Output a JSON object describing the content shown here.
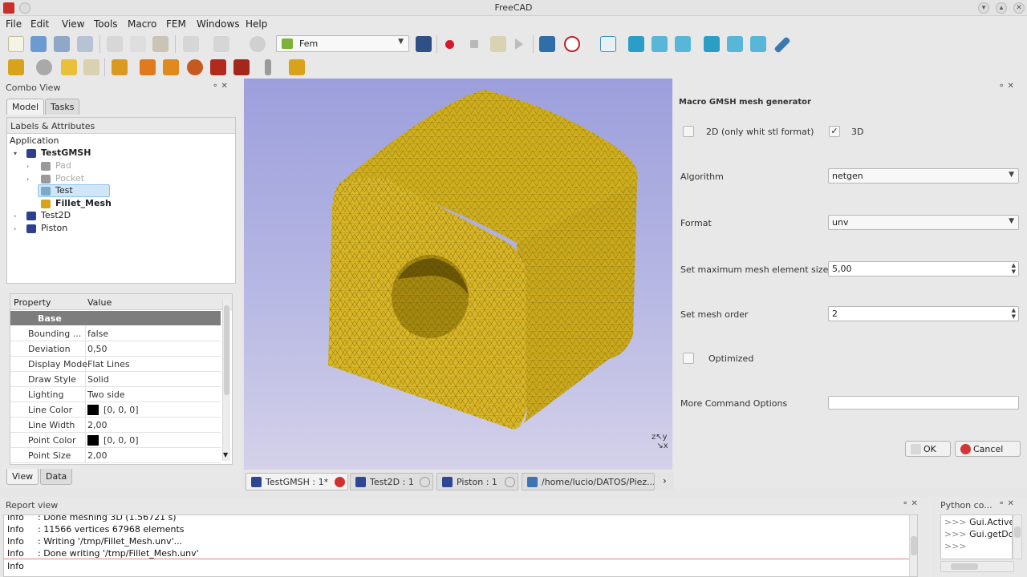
{
  "window": {
    "title": "FreeCAD"
  },
  "menu": [
    "File",
    "Edit",
    "View",
    "Tools",
    "Macro",
    "FEM",
    "Windows",
    "Help"
  ],
  "toolbar": {
    "workbench": "Fem"
  },
  "combo_view": {
    "title": "Combo View",
    "tabs": [
      "Model",
      "Tasks"
    ],
    "tree": {
      "header": "Labels & Attributes",
      "root": "Application",
      "items": [
        "TestGMSH",
        "Pad",
        "Pocket",
        "Test",
        "Fillet_Mesh",
        "Test2D",
        "Piston"
      ]
    },
    "properties": {
      "col_property": "Property",
      "col_value": "Value",
      "group": "Base",
      "rows": [
        {
          "name": "Bounding ...",
          "value": "false"
        },
        {
          "name": "Deviation",
          "value": "0,50"
        },
        {
          "name": "Display Mode",
          "value": "Flat Lines"
        },
        {
          "name": "Draw Style",
          "value": "Solid"
        },
        {
          "name": "Lighting",
          "value": "Two side"
        },
        {
          "name": "Line Color",
          "value": "[0, 0, 0]"
        },
        {
          "name": "Line Width",
          "value": "2,00"
        },
        {
          "name": "Point Color",
          "value": "[0, 0, 0]"
        },
        {
          "name": "Point Size",
          "value": "2,00"
        }
      ]
    },
    "bottom_tabs": [
      "View",
      "Data"
    ]
  },
  "doc_tabs": [
    "TestGMSH : 1*",
    "Test2D : 1",
    "Piston : 1",
    "/home/lucio/DATOS/Piez..."
  ],
  "task_panel": {
    "title": "Macro GMSH mesh generator",
    "opt_2d_label": "2D (only whit stl format)",
    "opt_2d_checked": false,
    "opt_3d_label": "3D",
    "opt_3d_checked": true,
    "algorithm_label": "Algorithm",
    "algorithm_value": "netgen",
    "format_label": "Format",
    "format_value": "unv",
    "max_size_label": "Set maximum mesh element size",
    "max_size_value": "5,00",
    "order_label": "Set mesh order",
    "order_value": "2",
    "optimized_label": "Optimized",
    "optimized_checked": false,
    "more_options_label": "More Command Options",
    "more_options_value": "",
    "ok_label": "OK",
    "cancel_label": "Cancel"
  },
  "report_view": {
    "title": "Report view",
    "lines": [
      {
        "type": "Info",
        "text": ": Done meshing 3D (1.56721 s)"
      },
      {
        "type": "Info",
        "text": ": 11566 vertices 67968 elements"
      },
      {
        "type": "Info",
        "text": ": Writing '/tmp/Fillet_Mesh.unv'..."
      },
      {
        "type": "Info",
        "text": ": Done writing '/tmp/Fillet_Mesh.unv'"
      },
      {
        "type": "Info",
        "text": ""
      }
    ]
  },
  "python_console": {
    "title": "Python co...",
    "lines": [
      {
        "prompt": ">>>",
        "text": "Gui.Active("
      },
      {
        "prompt": ">>>",
        "text": "Gui.getDoc"
      },
      {
        "prompt": ">>>",
        "text": ""
      }
    ]
  },
  "colors": {
    "mesh_fill": "#d6b21f",
    "viewport_top": "#9c9fdc",
    "viewport_bottom": "#d4d1e9",
    "selection": "#cfe6f7"
  }
}
